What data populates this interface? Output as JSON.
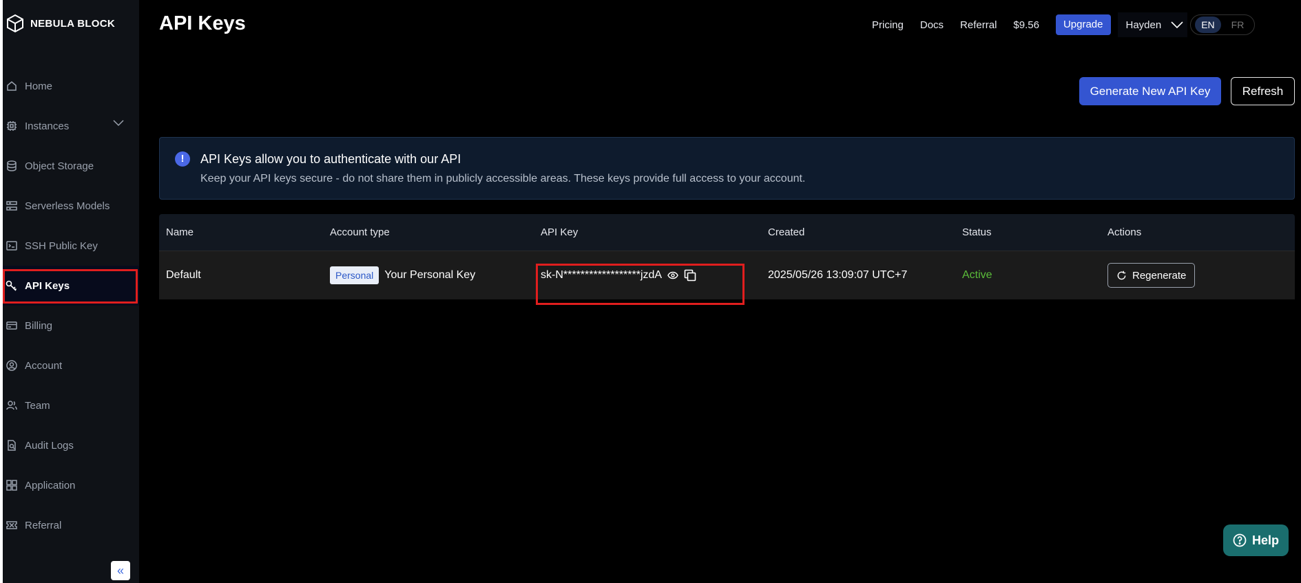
{
  "brand": {
    "name": "NEBULA BLOCK"
  },
  "sidebar": {
    "items": [
      {
        "label": "Home",
        "icon": "home-icon"
      },
      {
        "label": "Instances",
        "icon": "chip-icon"
      },
      {
        "label": "Object Storage",
        "icon": "database-icon"
      },
      {
        "label": "Serverless Models",
        "icon": "server-icon"
      },
      {
        "label": "SSH Public Key",
        "icon": "terminal-icon"
      },
      {
        "label": "API Keys",
        "icon": "key-icon",
        "active": true
      },
      {
        "label": "Billing",
        "icon": "billing-icon"
      },
      {
        "label": "Account",
        "icon": "user-circle-icon"
      },
      {
        "label": "Team",
        "icon": "team-icon"
      },
      {
        "label": "Audit Logs",
        "icon": "audit-icon"
      },
      {
        "label": "Application",
        "icon": "apps-icon"
      },
      {
        "label": "Referral",
        "icon": "ticket-icon"
      }
    ]
  },
  "header": {
    "title": "API Keys",
    "links": {
      "pricing": "Pricing",
      "docs": "Docs",
      "referral": "Referral"
    },
    "balance": "$9.56",
    "upgrade_label": "Upgrade",
    "user_name": "Hayden",
    "languages": {
      "en": "EN",
      "fr": "FR"
    }
  },
  "actions": {
    "generate_label": "Generate New API Key",
    "refresh_label": "Refresh"
  },
  "info": {
    "title": "API Keys allow you to authenticate with our API",
    "description": "Keep your API keys secure - do not share them in publicly accessible areas. These keys provide full access to your account."
  },
  "table": {
    "headers": {
      "name": "Name",
      "account_type": "Account type",
      "api_key": "API Key",
      "created": "Created",
      "status": "Status",
      "actions": "Actions"
    },
    "rows": [
      {
        "name": "Default",
        "badge": "Personal",
        "account_type": "Your Personal Key",
        "api_key": "sk-N******************jzdA",
        "created": "2025/05/26 13:09:07 UTC+7",
        "status": "Active",
        "action_label": "Regenerate"
      }
    ]
  },
  "help": {
    "label": "Help"
  },
  "colors": {
    "accent": "#3455d1",
    "active_status": "#5bbd3a",
    "highlight": "#e01e1e",
    "help": "#1a6e6e"
  }
}
